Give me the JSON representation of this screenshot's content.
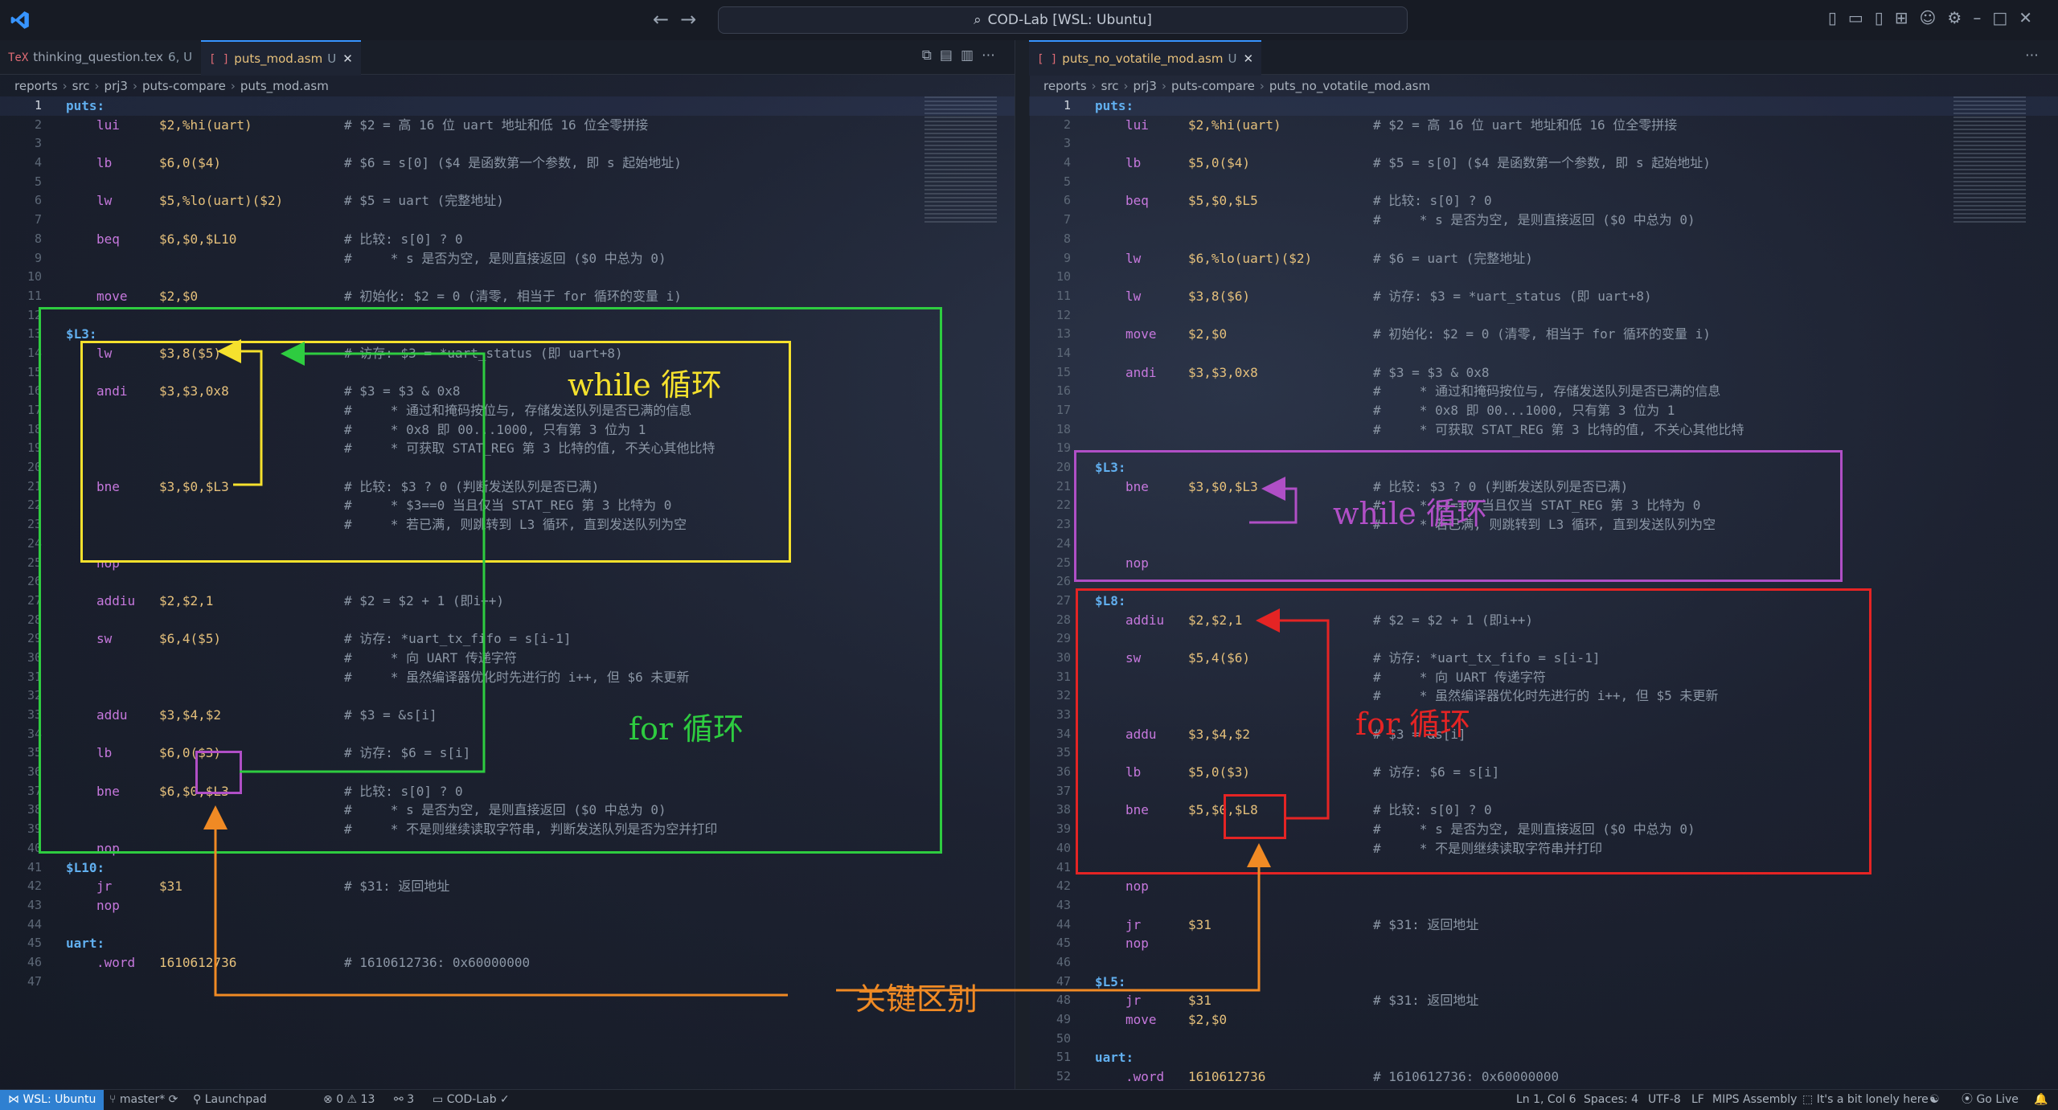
{
  "window": {
    "title": "COD-Lab [WSL: Ubuntu]"
  },
  "left": {
    "tabs": [
      {
        "icon": "TeX",
        "label": "thinking_question.tex",
        "status": "6, U"
      },
      {
        "icon": "[ ]",
        "label": "puts_mod.asm",
        "status": "U"
      }
    ],
    "breadcrumb": [
      "reports",
      "src",
      "prj3",
      "puts-compare",
      "puts_mod.asm"
    ],
    "lines": [
      {
        "n": "1",
        "lbl": "puts:"
      },
      {
        "n": "2",
        "op": "lui",
        "args": "$2,%hi(uart)",
        "cmt": "# $2 = 高 16 位 uart 地址和低 16 位全零拼接"
      },
      {
        "n": "3"
      },
      {
        "n": "4",
        "op": "lb",
        "args": "$6,0($4)",
        "cmt": "# $6 = s[0] ($4 是函数第一个参数, 即 s 起始地址)"
      },
      {
        "n": "5"
      },
      {
        "n": "6",
        "op": "lw",
        "args": "$5,%lo(uart)($2)",
        "cmt": "# $5 = uart (完整地址)"
      },
      {
        "n": "7"
      },
      {
        "n": "8",
        "op": "beq",
        "args": "$6,$0,$L10",
        "cmt": "# 比较: s[0] ? 0"
      },
      {
        "n": "9",
        "cmt": "#     * s 是否为空, 是则直接返回 ($0 中总为 0)"
      },
      {
        "n": "10"
      },
      {
        "n": "11",
        "op": "move",
        "args": "$2,$0",
        "cmt": "# 初始化: $2 = 0 (清零, 相当于 for 循环的变量 i)"
      },
      {
        "n": "12"
      },
      {
        "n": "13",
        "lbl": "$L3:"
      },
      {
        "n": "14",
        "op": "lw",
        "args": "$3,8($5)",
        "cmt": "# 访存: $3 = *uart_status (即 uart+8)"
      },
      {
        "n": "15"
      },
      {
        "n": "16",
        "op": "andi",
        "args": "$3,$3,0x8",
        "cmt": "# $3 = $3 & 0x8"
      },
      {
        "n": "17",
        "cmt": "#     * 通过和掩码按位与, 存储发送队列是否已满的信息"
      },
      {
        "n": "18",
        "cmt": "#     * 0x8 即 00...1000, 只有第 3 位为 1"
      },
      {
        "n": "19",
        "cmt": "#     * 可获取 STAT_REG 第 3 比特的值, 不关心其他比特"
      },
      {
        "n": "20"
      },
      {
        "n": "21",
        "op": "bne",
        "args": "$3,$0,$L3",
        "cmt": "# 比较: $3 ? 0 (判断发送队列是否已满)"
      },
      {
        "n": "22",
        "cmt": "#     * $3==0 当且仅当 STAT_REG 第 3 比特为 0"
      },
      {
        "n": "23",
        "cmt": "#     * 若已满, 则跳转到 L3 循环, 直到发送队列为空"
      },
      {
        "n": "24"
      },
      {
        "n": "25",
        "op": "nop"
      },
      {
        "n": "26"
      },
      {
        "n": "27",
        "op": "addiu",
        "args": "$2,$2,1",
        "cmt": "# $2 = $2 + 1 (即i++)"
      },
      {
        "n": "28"
      },
      {
        "n": "29",
        "op": "sw",
        "args": "$6,4($5)",
        "cmt": "# 访存: *uart_tx_fifo = s[i-1]"
      },
      {
        "n": "30",
        "cmt": "#     * 向 UART 传递字符"
      },
      {
        "n": "31",
        "cmt": "#     * 虽然编译器优化时先进行的 i++, 但 $6 未更新"
      },
      {
        "n": "32"
      },
      {
        "n": "33",
        "op": "addu",
        "args": "$3,$4,$2",
        "cmt": "# $3 = &s[i]"
      },
      {
        "n": "34"
      },
      {
        "n": "35",
        "op": "lb",
        "args": "$6,0($3)",
        "cmt": "# 访存: $6 = s[i]"
      },
      {
        "n": "36"
      },
      {
        "n": "37",
        "op": "bne",
        "args": "$6,$0,$L3",
        "cmt": "# 比较: s[0] ? 0"
      },
      {
        "n": "38",
        "cmt": "#     * s 是否为空, 是则直接返回 ($0 中总为 0)"
      },
      {
        "n": "39",
        "cmt": "#     * 不是则继续读取字符串, 判断发送队列是否为空并打印"
      },
      {
        "n": "40",
        "op": "nop"
      },
      {
        "n": "41",
        "lbl": "$L10:"
      },
      {
        "n": "42",
        "op": "jr",
        "args": "$31",
        "cmt": "# $31: 返回地址"
      },
      {
        "n": "43",
        "op": "nop"
      },
      {
        "n": "44"
      },
      {
        "n": "45",
        "lbl": "uart:"
      },
      {
        "n": "46",
        "op": ".word",
        "args": "1610612736",
        "cmt": "# 1610612736: 0x60000000"
      },
      {
        "n": "47"
      }
    ],
    "annotations": {
      "while": "while 循环",
      "for": "for 循环",
      "key": "关键区别"
    }
  },
  "right": {
    "tabs": [
      {
        "icon": "[ ]",
        "label": "puts_no_votatile_mod.asm",
        "status": "U"
      }
    ],
    "breadcrumb": [
      "reports",
      "src",
      "prj3",
      "puts-compare",
      "puts_no_votatile_mod.asm"
    ],
    "lines": [
      {
        "n": "1",
        "lbl": "puts:"
      },
      {
        "n": "2",
        "op": "lui",
        "args": "$2,%hi(uart)",
        "cmt": "# $2 = 高 16 位 uart 地址和低 16 位全零拼接"
      },
      {
        "n": "3"
      },
      {
        "n": "4",
        "op": "lb",
        "args": "$5,0($4)",
        "cmt": "# $5 = s[0] ($4 是函数第一个参数, 即 s 起始地址)"
      },
      {
        "n": "5"
      },
      {
        "n": "6",
        "op": "beq",
        "args": "$5,$0,$L5",
        "cmt": "# 比较: s[0] ? 0"
      },
      {
        "n": "7",
        "cmt": "#     * s 是否为空, 是则直接返回 ($0 中总为 0)"
      },
      {
        "n": "8"
      },
      {
        "n": "9",
        "op": "lw",
        "args": "$6,%lo(uart)($2)",
        "cmt": "# $6 = uart (完整地址)"
      },
      {
        "n": "10"
      },
      {
        "n": "11",
        "op": "lw",
        "args": "$3,8($6)",
        "cmt": "# 访存: $3 = *uart_status (即 uart+8)"
      },
      {
        "n": "12"
      },
      {
        "n": "13",
        "op": "move",
        "args": "$2,$0",
        "cmt": "# 初始化: $2 = 0 (清零, 相当于 for 循环的变量 i)"
      },
      {
        "n": "14"
      },
      {
        "n": "15",
        "op": "andi",
        "args": "$3,$3,0x8",
        "cmt": "# $3 = $3 & 0x8"
      },
      {
        "n": "16",
        "cmt": "#     * 通过和掩码按位与, 存储发送队列是否已满的信息"
      },
      {
        "n": "17",
        "cmt": "#     * 0x8 即 00...1000, 只有第 3 位为 1"
      },
      {
        "n": "18",
        "cmt": "#     * 可获取 STAT_REG 第 3 比特的值, 不关心其他比特"
      },
      {
        "n": "19"
      },
      {
        "n": "20",
        "lbl": "$L3:"
      },
      {
        "n": "21",
        "op": "bne",
        "args": "$3,$0,$L3",
        "cmt": "# 比较: $3 ? 0 (判断发送队列是否已满)"
      },
      {
        "n": "22",
        "cmt": "#     * $3==0 当且仅当 STAT_REG 第 3 比特为 0"
      },
      {
        "n": "23",
        "cmt": "#     * 若已满, 则跳转到 L3 循环, 直到发送队列为空"
      },
      {
        "n": "24"
      },
      {
        "n": "25",
        "op": "nop"
      },
      {
        "n": "26"
      },
      {
        "n": "27",
        "lbl": "$L8:"
      },
      {
        "n": "28",
        "op": "addiu",
        "args": "$2,$2,1",
        "cmt": "# $2 = $2 + 1 (即i++)"
      },
      {
        "n": "29"
      },
      {
        "n": "30",
        "op": "sw",
        "args": "$5,4($6)",
        "cmt": "# 访存: *uart_tx_fifo = s[i-1]"
      },
      {
        "n": "31",
        "cmt": "#     * 向 UART 传递字符"
      },
      {
        "n": "32",
        "cmt": "#     * 虽然编译器优化时先进行的 i++, 但 $5 未更新"
      },
      {
        "n": "33"
      },
      {
        "n": "34",
        "op": "addu",
        "args": "$3,$4,$2",
        "cmt": "# $3 = &s[i]"
      },
      {
        "n": "35"
      },
      {
        "n": "36",
        "op": "lb",
        "args": "$5,0($3)",
        "cmt": "# 访存: $6 = s[i]"
      },
      {
        "n": "37"
      },
      {
        "n": "38",
        "op": "bne",
        "args": "$5,$0,$L8",
        "cmt": "# 比较: s[0] ? 0"
      },
      {
        "n": "39",
        "cmt": "#     * s 是否为空, 是则直接返回 ($0 中总为 0)"
      },
      {
        "n": "40",
        "cmt": "#     * 不是则继续读取字符串并打印"
      },
      {
        "n": "41"
      },
      {
        "n": "42",
        "op": "nop"
      },
      {
        "n": "43"
      },
      {
        "n": "44",
        "op": "jr",
        "args": "$31",
        "cmt": "# $31: 返回地址"
      },
      {
        "n": "45",
        "op": "nop"
      },
      {
        "n": "46"
      },
      {
        "n": "47",
        "lbl": "$L5:"
      },
      {
        "n": "48",
        "op": "jr",
        "args": "$31",
        "cmt": "# $31: 返回地址"
      },
      {
        "n": "49",
        "op": "move",
        "args": "$2,$0"
      },
      {
        "n": "50"
      },
      {
        "n": "51",
        "lbl": "uart:"
      },
      {
        "n": "52",
        "op": ".word",
        "args": "1610612736",
        "cmt": "# 1610612736: 0x60000000"
      }
    ],
    "annotations": {
      "while": "while 循环",
      "for": "for 循环"
    }
  },
  "status": {
    "remote": "WSL: Ubuntu",
    "branch": "master*",
    "launchpad": "Launchpad",
    "problems": "0 ⚠ 13",
    "ports": "3",
    "project": "COD-Lab",
    "cursor": "Ln 1, Col 6",
    "spaces": "Spaces: 4",
    "encoding": "UTF-8",
    "eol": "LF",
    "language": "MIPS Assembly",
    "lonely": "It's a bit lonely here",
    "golive": "Go Live"
  },
  "colors": {
    "accent": "#3794ff",
    "yellow": "#f5e12d",
    "green": "#2ecc40",
    "purple": "#b04fc6",
    "red": "#e52424",
    "orange": "#f08a24"
  }
}
